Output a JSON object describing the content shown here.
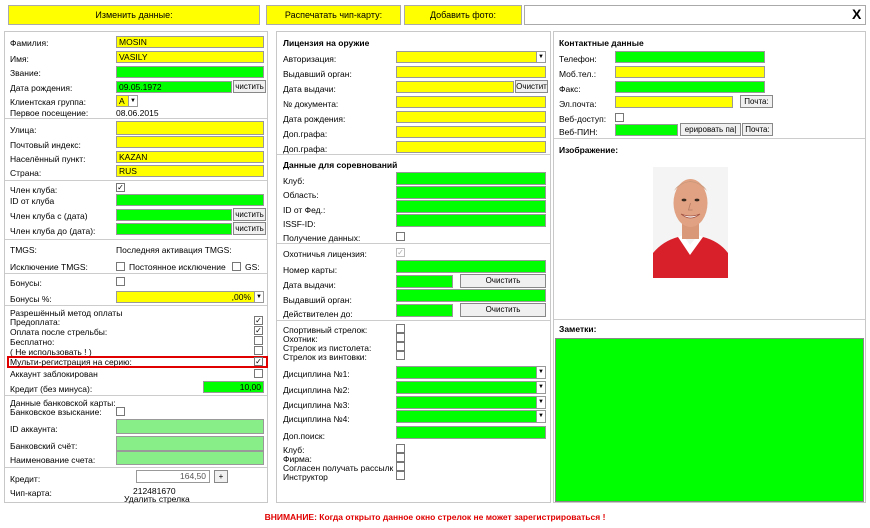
{
  "toolbar": {
    "edit": "Изменить данные:",
    "print": "Распечатать чип-карту:",
    "photo": "Добавить фото:",
    "close": "X"
  },
  "person": {
    "surname_label": "Фамилия:",
    "surname": "MOSIN",
    "name_label": "Имя:",
    "name": "VASILY",
    "rank_label": "Звание:",
    "rank": "",
    "birth_label": "Дата рождения:",
    "birth": "09.05.1972",
    "clear": "чистить",
    "group_label": "Клиентская группа:",
    "group": "A",
    "first_visit_label": "Первое посещение:",
    "first_visit": "08.06.2015"
  },
  "address": {
    "street": "Улица:",
    "zip": "Почтовый индекс:",
    "city_label": "Населённый пункт:",
    "city": "KAZAN",
    "country_label": "Страна:",
    "country": "RUS"
  },
  "club": {
    "member": "Член клуба:",
    "id": "ID от клуба",
    "from": "Член клуба с (дата)",
    "to": "Член клуба до (дата):",
    "clear": "чистить"
  },
  "tmgs": {
    "label": "TMGS:",
    "last": "Последняя активация TMGS:",
    "exclude": "Исключение TMGS:",
    "perm": "Постоянное исключение",
    "gs": "GS:"
  },
  "bonus": {
    "label": "Бонусы:",
    "pct_label": "Бонусы %:",
    "pct": ",00%"
  },
  "payment": {
    "title": "Разрешённый метод оплаты",
    "prepay": "Предоплата:",
    "post": "Оплата после стрельбы:",
    "free": "Бесплатно:",
    "unused": "( Не использовать ! )",
    "multi": "Мульти-регистрация на серию:",
    "blocked": "Аккаунт заблокирован",
    "credit_label": "Кредит (без минуса):",
    "credit": "10,00"
  },
  "bank": {
    "title": "Данные банковской карты:",
    "collect": "Банковское взыскание:",
    "id": "ID аккаунта:",
    "account": "Банковский счёт:",
    "name": "Наименование счета:"
  },
  "footer_left": {
    "credit_label": "Кредит:",
    "credit": "164,50",
    "plus": "+",
    "chip_label": "Чип-карта:",
    "chip": "212481670",
    "delete": "Удалить стрелка"
  },
  "weapon": {
    "title": "Лицензия на оружие",
    "auth": "Авторизация:",
    "issuer": "Выдавший орган:",
    "issued": "Дата выдачи:",
    "clear": "Очистит",
    "doc": "№ документа:",
    "birth": "Дата рождения:",
    "extra1": "Доп.графа:",
    "extra2": "Доп.графа:"
  },
  "comp": {
    "title": "Данные для соревнований",
    "club": "Клуб:",
    "region": "Область:",
    "fed": "ID от Фед.:",
    "issf": "ISSF-ID:",
    "receive": "Получение данных:"
  },
  "hunt": {
    "license": "Охотничья лицензия:",
    "card": "Номер карты:",
    "issued": "Дата выдачи:",
    "clear": "Очистить",
    "issuer": "Выдавший орган:",
    "valid": "Действителен до:"
  },
  "shooter": {
    "sport": "Спортивный стрелок:",
    "hunter": "Охотник:",
    "pistol": "Стрелок из пистолета:",
    "rifle": "Стрелок из винтовки:",
    "d1": "Дисциплина №1:",
    "d2": "Дисциплина №2:",
    "d3": "Дисциплина №3:",
    "d4": "Дисциплина №4:",
    "search": "Доп.поиск:",
    "club": "Клуб:",
    "firm": "Фирма:",
    "mail": "Согласен получать рассылк",
    "instr": "Инструктор"
  },
  "contact": {
    "title": "Контактные данные",
    "phone": "Телефон:",
    "mobile": "Моб.тел.:",
    "fax": "Факс:",
    "email": "Эл.почта:",
    "mail_btn": "Почта:",
    "web": "Веб-доступ:",
    "pin": "Веб-ПИН:",
    "gen": "ерировать па|",
    "mail_btn2": "Почта:",
    "image": "Изображение:"
  },
  "notes": {
    "label": "Заметки:"
  },
  "warning": "ВНИМАНИЕ: Когда открыто данное окно стрелок не может зарегистрироваться !"
}
